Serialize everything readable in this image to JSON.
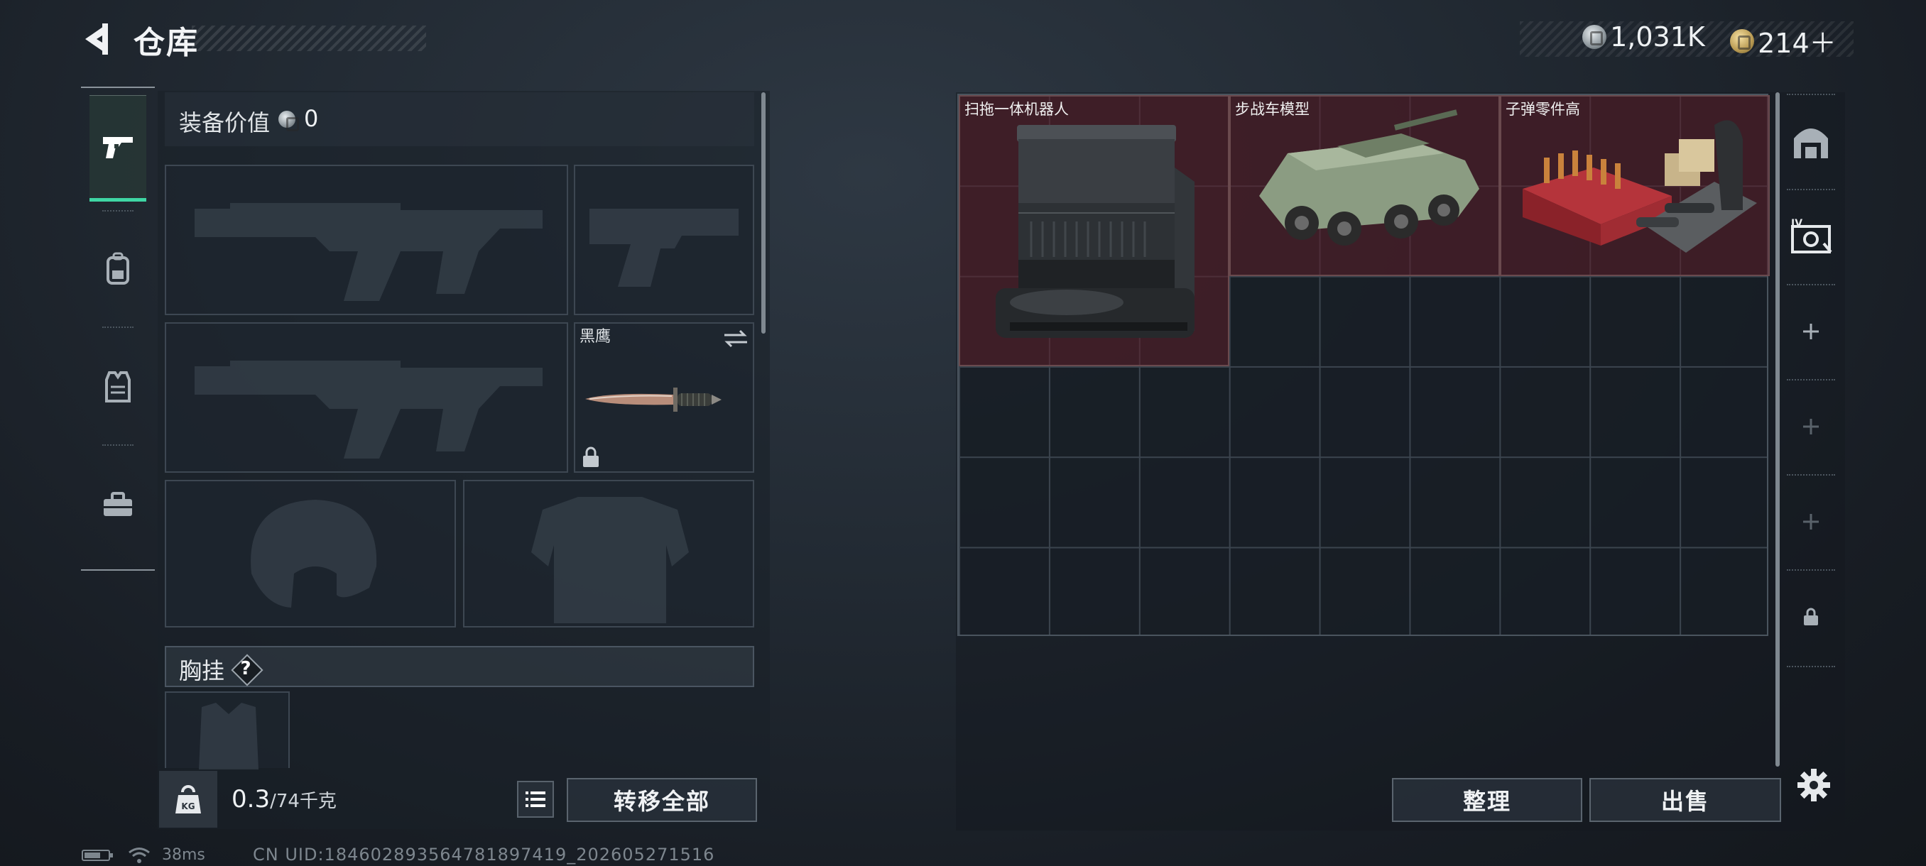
{
  "header": {
    "title": "仓库",
    "currency": [
      {
        "icon": "silver-coin-icon",
        "value": "1,031K"
      },
      {
        "icon": "gold-coin-icon",
        "value": "214＋"
      }
    ]
  },
  "left_tabs": [
    {
      "icon": "pistol-icon",
      "active": true
    },
    {
      "icon": "backpack-icon",
      "active": false
    },
    {
      "icon": "vest-icon",
      "active": false
    },
    {
      "icon": "toolbox-icon",
      "active": false
    }
  ],
  "equipment": {
    "value_label": "装备价值",
    "value": "0",
    "knife_name": "黑鹰",
    "rig_label": "胸挂",
    "rig_help": "?"
  },
  "footer_left": {
    "weight_current": "0.3",
    "weight_max": "/74千克",
    "transfer_all": "转移全部"
  },
  "storage": {
    "items": [
      {
        "name": "扫拖一体机器人",
        "icon": "robot-vacuum-icon"
      },
      {
        "name": "步战车模型",
        "icon": "ifv-model-icon"
      },
      {
        "name": "子弹零件高",
        "icon": "ammo-parts-crate-icon"
      }
    ],
    "sort_label": "整理",
    "sell_label": "出售"
  },
  "status": {
    "ping": "38ms",
    "uid": "CN UID:1846028935647818974​19_202605271516"
  },
  "colors": {
    "accent_tab": "#3fd6a4",
    "item_highlight": "#5c1e28"
  }
}
